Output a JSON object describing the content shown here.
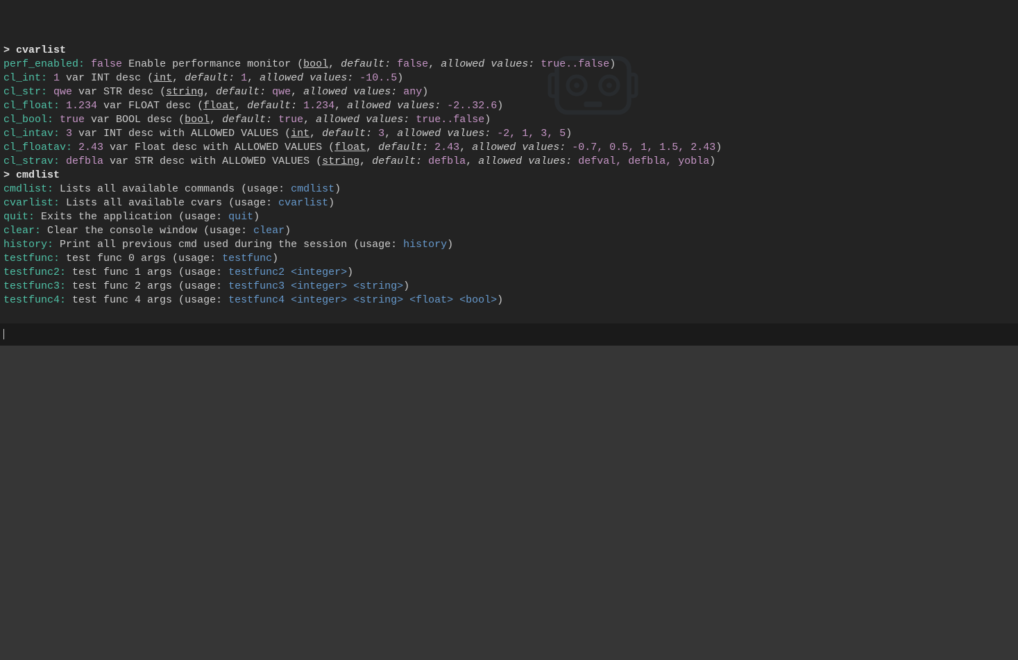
{
  "prompt_char": ">",
  "commands_run": [
    {
      "cmd": "cvarlist"
    },
    {
      "cmd": "cmdlist"
    }
  ],
  "cvars": [
    {
      "name": "perf_enabled",
      "value": "false",
      "desc": "Enable performance monitor",
      "type": "bool",
      "default": "false",
      "allowed": "true..false"
    },
    {
      "name": "cl_int",
      "value": "1",
      "desc": "var INT desc",
      "type": "int",
      "default": "1",
      "allowed": "-10..5"
    },
    {
      "name": "cl_str",
      "value": "qwe",
      "desc": "var STR desc",
      "type": "string",
      "default": "qwe",
      "allowed": "any"
    },
    {
      "name": "cl_float",
      "value": "1.234",
      "desc": "var FLOAT desc",
      "type": "float",
      "default": "1.234",
      "allowed": "-2..32.6"
    },
    {
      "name": "cl_bool",
      "value": "true",
      "desc": "var BOOL desc",
      "type": "bool",
      "default": "true",
      "allowed": "true..false"
    },
    {
      "name": "cl_intav",
      "value": "3",
      "desc": "var INT desc with ALLOWED VALUES",
      "type": "int",
      "default": "3",
      "allowed": "-2, 1, 3, 5"
    },
    {
      "name": "cl_floatav",
      "value": "2.43",
      "desc": "var Float desc with ALLOWED VALUES",
      "type": "float",
      "default": "2.43",
      "allowed": "-0.7, 0.5, 1, 1.5, 2.43"
    },
    {
      "name": "cl_strav",
      "value": "defbla",
      "desc": "var STR desc with ALLOWED VALUES",
      "type": "string",
      "default": "defbla",
      "allowed": "defval, defbla, yobla"
    }
  ],
  "cmds": [
    {
      "name": "cmdlist",
      "desc": "Lists all available commands",
      "usage": "cmdlist"
    },
    {
      "name": "cvarlist",
      "desc": "Lists all available cvars",
      "usage": "cvarlist"
    },
    {
      "name": "quit",
      "desc": "Exits the application",
      "usage": "quit"
    },
    {
      "name": "clear",
      "desc": "Clear the console window",
      "usage": "clear"
    },
    {
      "name": "history",
      "desc": "Print all previous cmd used during the session",
      "usage": "history"
    },
    {
      "name": "testfunc",
      "desc": "test func 0 args",
      "usage": "testfunc"
    },
    {
      "name": "testfunc2",
      "desc": "test func 1 args",
      "usage": "testfunc2 <integer>"
    },
    {
      "name": "testfunc3",
      "desc": "test func 2 args",
      "usage": "testfunc3 <integer> <string>"
    },
    {
      "name": "testfunc4",
      "desc": "test func 4 args",
      "usage": "testfunc4 <integer> <string> <float> <bool>"
    }
  ],
  "labels": {
    "default": "default:",
    "allowed": "allowed values:",
    "usage": "usage:"
  },
  "input_value": ""
}
